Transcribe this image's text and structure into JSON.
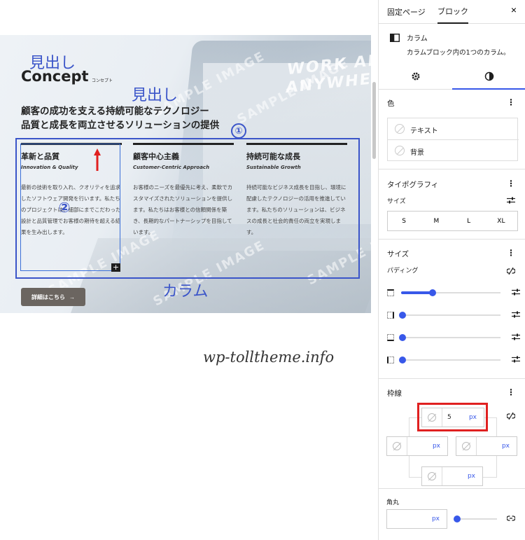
{
  "annotations": {
    "midashi_1": "見出し",
    "midashi_2": "見出し",
    "num_1": "①",
    "num_2": "②",
    "column": "カラム"
  },
  "hero": {
    "title": "Concept",
    "title_sub": "コンセプト",
    "lead_1": "顧客の成功を支える持続可能なテクノロジー",
    "lead_2": "品質と成長を両立させるソリューションの提供",
    "watermark_lines": [
      "SAMPLE IMAGE",
      "SAMPLE IMAGE",
      "SAMPLE IMAGE",
      "SAMPLE IMAGE",
      "SAMPLE IMAGE"
    ],
    "laptop_text_1": "WORK AN",
    "laptop_text_2": "ANYWHER",
    "columns": [
      {
        "heading": "革新と品質",
        "en": "Innovation & Quality",
        "body": "最新の技術を取り入れ、クオリティを追求したソフトウェア開発を行います。私たちのプロジェクトは、細部にまでこだわった設計と品質管理でお客様の期待を超える結果を生み出します。"
      },
      {
        "heading": "顧客中心主義",
        "en": "Customer-Centric Approach",
        "body": "お客様のニーズを最優先に考え、柔軟でカスタマイズされたソリューションを提供します。私たちはお客様との信頼関係を築き、長期的なパートナーシップを目指しています。"
      },
      {
        "heading": "持続可能な成長",
        "en": "Sustainable Growth",
        "body": "持続可能なビジネス成長を目指し、環境に配慮したテクノロジーの活用を推進しています。私たちのソリューションは、ビジネスの成長と社会的責任の両立を実現します。"
      }
    ],
    "button_label": "詳細はこちら",
    "button_arrow": "→",
    "add_block": "+"
  },
  "site_watermark": "wp-tolltheme.info",
  "sidebar": {
    "tabs": [
      "固定ページ",
      "ブロック"
    ],
    "active_tab": 1,
    "close": "×",
    "block": {
      "name": "カラム",
      "description": "カラムブロック内の1つのカラム。"
    },
    "color": {
      "title": "色",
      "text": "テキスト",
      "background": "背景"
    },
    "typography": {
      "title": "タイポグラフィ",
      "size_label": "サイズ",
      "presets": [
        "S",
        "M",
        "L",
        "XL"
      ]
    },
    "dimensions": {
      "title": "サイズ",
      "padding_label": "パディング",
      "padding_levels": [
        0.3,
        0,
        0,
        0
      ]
    },
    "border": {
      "title": "枠線",
      "top_value": "5",
      "unit": "px"
    },
    "radius": {
      "label": "角丸",
      "unit": "px",
      "level": 0
    },
    "kebab": "⋮",
    "accent": "#3858e9",
    "highlight": "#e02020"
  }
}
